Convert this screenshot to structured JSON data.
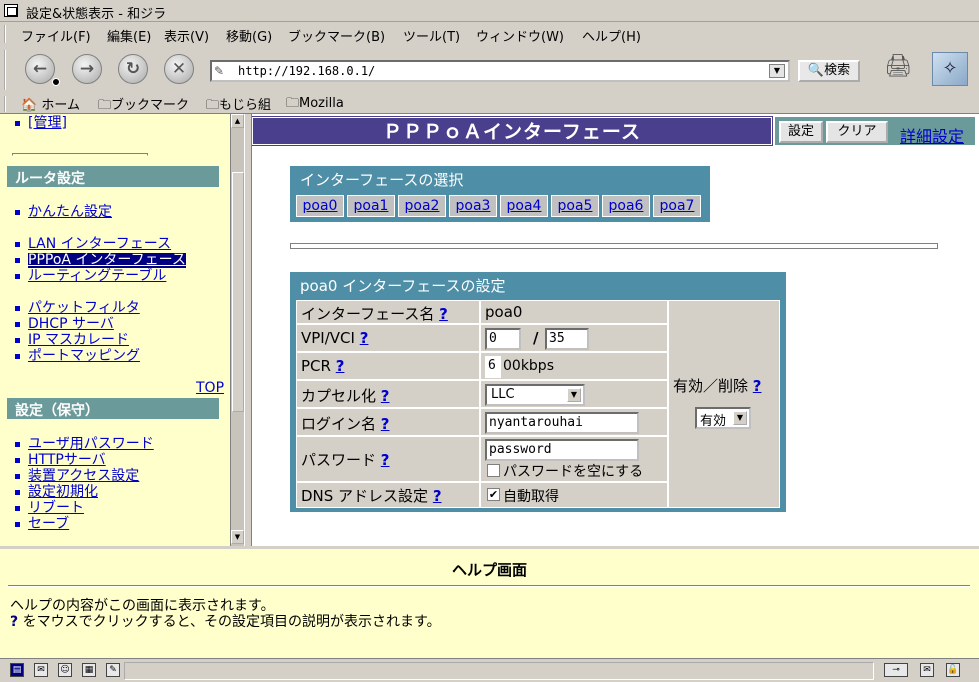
{
  "window": {
    "title": "設定&状態表示 - 和ジラ"
  },
  "menu": [
    "ファイル(F)",
    "編集(E)",
    "表示(V)",
    "移動(G)",
    "ブックマーク(B)",
    "ツール(T)",
    "ウィンドウ(W)",
    "ヘルプ(H)"
  ],
  "nav": {
    "url": "http://192.168.0.1/",
    "search_label": "検索"
  },
  "bookmarks": {
    "home": "ホーム",
    "b1": "ブックマーク",
    "b2": "もじら組",
    "b3": "Mozilla"
  },
  "sidebar": {
    "admin_link": "[管理]",
    "router_heading": "ルータ設定",
    "router_links": [
      "かんたん設定",
      "LAN インターフェース",
      "PPPoA インターフェース",
      "ルーティングテーブル",
      "パケットフィルタ",
      "DHCP サーバ",
      "IP マスカレード",
      "ポートマッピング"
    ],
    "top_link": "TOP",
    "maint_heading": "設定（保守）",
    "maint_links": [
      "ユーザ用パスワード",
      "HTTPサーバ",
      "装置アクセス設定",
      "設定初期化",
      "リブート",
      "セーブ"
    ]
  },
  "main": {
    "title": "ＰＰＰｏＡインターフェース",
    "btn_set": "設定",
    "btn_clear": "クリア",
    "detail_link": "詳細設定",
    "select_title": "インターフェースの選択",
    "interfaces": [
      "poa0",
      "poa1",
      "poa2",
      "poa3",
      "poa4",
      "poa5",
      "poa6",
      "poa7"
    ],
    "config_title": "poa0 インターフェースの設定",
    "help_mark": "?",
    "labels": {
      "ifname": "インターフェース名",
      "vpivci": "VPI/VCI",
      "pcr": "PCR",
      "encap": "カプセル化",
      "login": "ログイン名",
      "password": "パスワード",
      "dns": "DNS アドレス設定",
      "enable": "有効／削除"
    },
    "values": {
      "ifname": "poa0",
      "vpi": "0",
      "vci": "35",
      "slash": "/",
      "pcr": "6",
      "pcr_unit": "00kbps",
      "encap": "LLC",
      "login": "nyantarouhai",
      "password": "password",
      "empty_pw_label": "パスワードを空にする",
      "empty_pw_checked": false,
      "dns_auto_label": "自動取得",
      "dns_auto_checked": true,
      "enable": "有効"
    }
  },
  "help": {
    "title": "ヘルプ画面",
    "line1": "ヘルプの内容がこの画面に表示されます。",
    "q": "?",
    "line2": " をマウスでクリックすると、その設定項目の説明が表示されます。"
  }
}
